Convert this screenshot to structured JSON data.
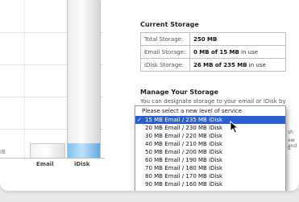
{
  "chart": {
    "axis_fragment": "IB",
    "bars": [
      {
        "label": "Email"
      },
      {
        "label": "iDisk"
      }
    ]
  },
  "current_storage": {
    "title": "Current Storage",
    "rows": [
      {
        "key": "Total Storage:",
        "value": "250 MB",
        "suffix": ""
      },
      {
        "key": "Email Storage:",
        "value": "0 MB of 15 MB",
        "suffix": " in use"
      },
      {
        "key": "iDisk Storage:",
        "value": "26 MB of 235 MB",
        "suffix": " in use"
      }
    ]
  },
  "manage": {
    "title": "Manage Your Storage",
    "description": "You can designate storage to your email or iDisk by",
    "side_note_1": "sh",
    "side_note_2": "ew and",
    "side_note_3": "s."
  },
  "dropdown": {
    "header": "Please select a new level of service",
    "selected_index": 0,
    "options": [
      "15 MB Email / 235 MB iDisk",
      "20 MB Email / 230 MB iDisk",
      "30 MB Email / 220 MB iDisk",
      "40 MB Email / 210 MB iDisk",
      "50 MB Email / 200 MB iDisk",
      "60 MB Email / 190 MB iDisk",
      "70 MB Email / 180 MB iDisk",
      "80 MB Email / 170 MB iDisk",
      "90 MB Email / 160 MB iDisk"
    ],
    "check_mark": "✓"
  },
  "cursor_icon": "arrow-pointer-icon"
}
